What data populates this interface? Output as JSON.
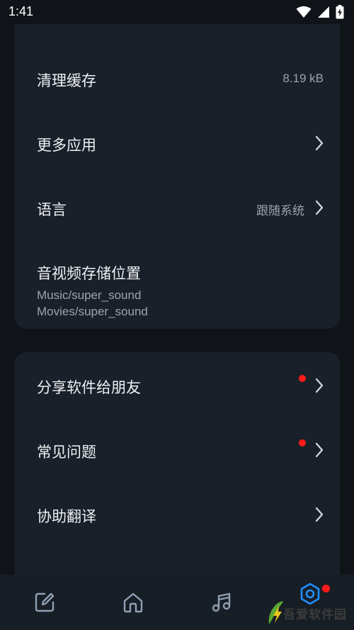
{
  "status_bar": {
    "time": "1:41",
    "icons": [
      "wifi-icon",
      "cellular-signal-icon",
      "battery-charging-icon"
    ]
  },
  "settings_group_1": [
    {
      "label": "清理缓存",
      "value": "8.19 kB"
    },
    {
      "label": "更多应用"
    },
    {
      "label": "语言",
      "value": "跟随系统"
    },
    {
      "label": "音视频存储位置",
      "paths": [
        "Music/super_sound",
        "Movies/super_sound"
      ]
    }
  ],
  "settings_group_2": [
    {
      "label": "分享软件给朋友",
      "badge": true
    },
    {
      "label": "常见问题",
      "badge": true
    },
    {
      "label": "协助翻译"
    }
  ],
  "bottom_nav": {
    "items": [
      "edit-icon",
      "home-icon",
      "music-note-icon",
      "settings-hex-icon"
    ],
    "active": "settings-hex-icon",
    "active_color": "#1e90ff",
    "badge_color": "#ff1a1a"
  },
  "watermark": {
    "text": "吾爱软件园",
    "url": "www.52xue.com"
  },
  "colors": {
    "background": "#101419",
    "card": "#1a2029",
    "text_primary": "#eef1f4",
    "text_secondary": "#9aa3ad"
  }
}
